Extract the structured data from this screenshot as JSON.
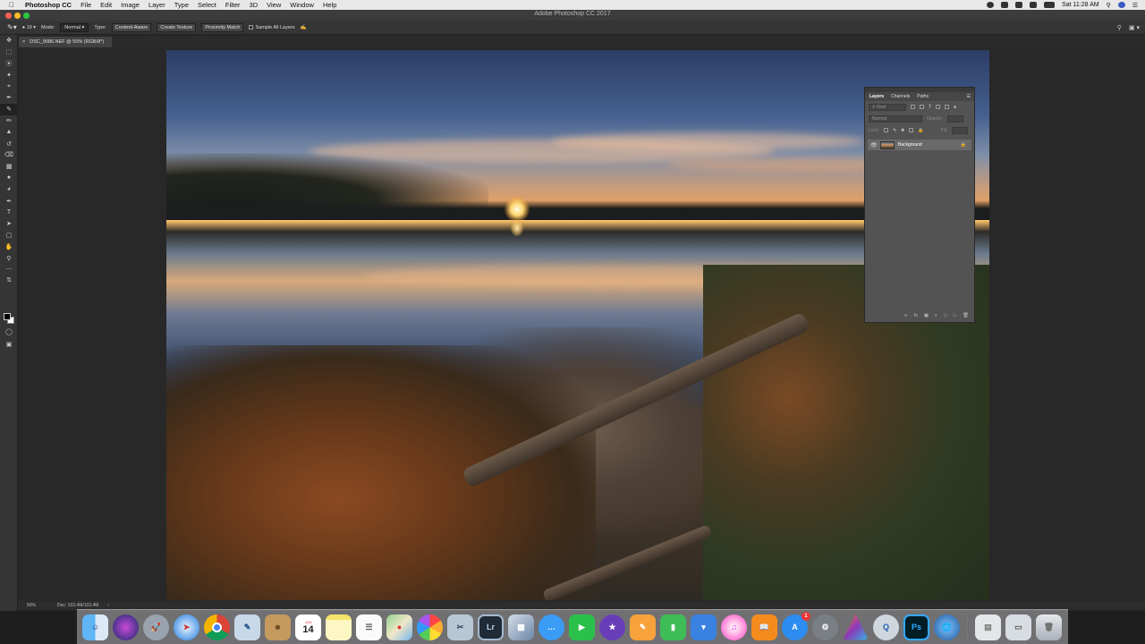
{
  "menubar": {
    "app_name": "Photoshop CC",
    "menus": [
      "File",
      "Edit",
      "Image",
      "Layer",
      "Type",
      "Select",
      "Filter",
      "3D",
      "View",
      "Window",
      "Help"
    ],
    "clock": "Sat 11:28 AM"
  },
  "window": {
    "title": "Adobe Photoshop CC 2017"
  },
  "options_bar": {
    "brush_size": "19",
    "mode_label": "Mode:",
    "mode_value": "Normal",
    "type_label": "Type:",
    "type_content_aware": "Content-Aware",
    "type_create_texture": "Create Texture",
    "type_proximity_match": "Proximity Match",
    "sample_all_layers": "Sample All Layers"
  },
  "document": {
    "tab_title": "DSC_9086.NEF @ 50% (RGB/8*)"
  },
  "layers_panel": {
    "tabs": [
      "Layers",
      "Channels",
      "Paths"
    ],
    "active_tab": "Layers",
    "kind_placeholder": "Kind",
    "blend_mode": "Normal",
    "opacity_label": "Opacity:",
    "lock_label": "Lock:",
    "fill_label": "Fill:",
    "layers": [
      {
        "name": "Background",
        "visible": true,
        "locked": true
      }
    ]
  },
  "status_bar": {
    "zoom": "50%",
    "doc_size": "Doc: 103.4M/103.4M"
  },
  "dock": {
    "calendar_month": "JUN",
    "calendar_day": "14",
    "app_store_badge": "1",
    "lightroom_label": "Lr",
    "photoshop_label": "Ps"
  }
}
